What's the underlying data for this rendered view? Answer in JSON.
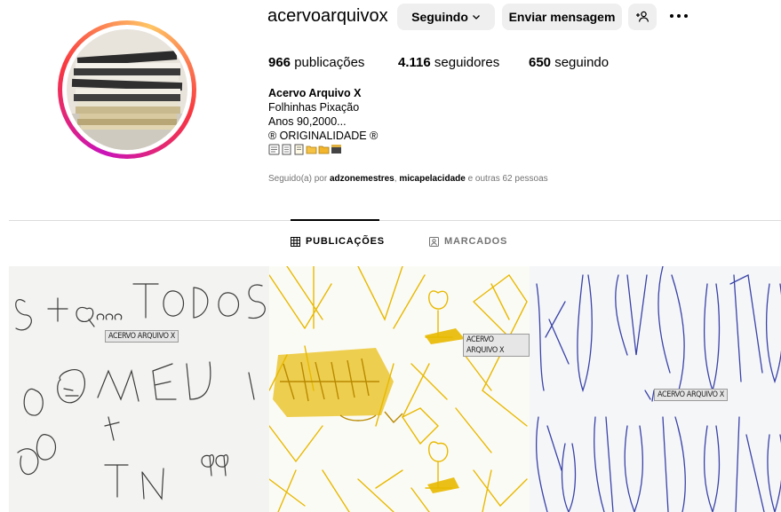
{
  "profile": {
    "username": "acervoarquivox",
    "follow_button": "Seguindo",
    "message_button": "Enviar mensagem",
    "stats": {
      "posts_count": "966",
      "posts_label": "publicações",
      "followers_count": "4.116",
      "followers_label": "seguidores",
      "following_count": "650",
      "following_label": "seguindo"
    },
    "bio": {
      "name": "Acervo Arquivo X",
      "line1": "Folhinhas Pixação",
      "line2": "Anos 90,2000...",
      "line3": "® ORIGINALIDADE ®"
    },
    "followed_by": {
      "prefix": "Seguido(a) por ",
      "user1": "adzonemestres",
      "sep": ", ",
      "user2": "micapelacidade",
      "suffix": " e outras 62 pessoas"
    }
  },
  "tabs": {
    "posts": "PUBLICAÇÕES",
    "tagged": "MARCADOS"
  },
  "posts": [
    {
      "watermark": "ACERVO ARQUIVO X"
    },
    {
      "watermark": "ACERVO ARQUIVO X"
    },
    {
      "watermark": "ACERVO ARQUIVO X"
    }
  ],
  "colors": {
    "button_bg": "#efefef",
    "muted_text": "#737373",
    "divider": "#dbdbdb",
    "yellow_ink": "#e8b900",
    "blue_ink": "#3a43a8"
  }
}
